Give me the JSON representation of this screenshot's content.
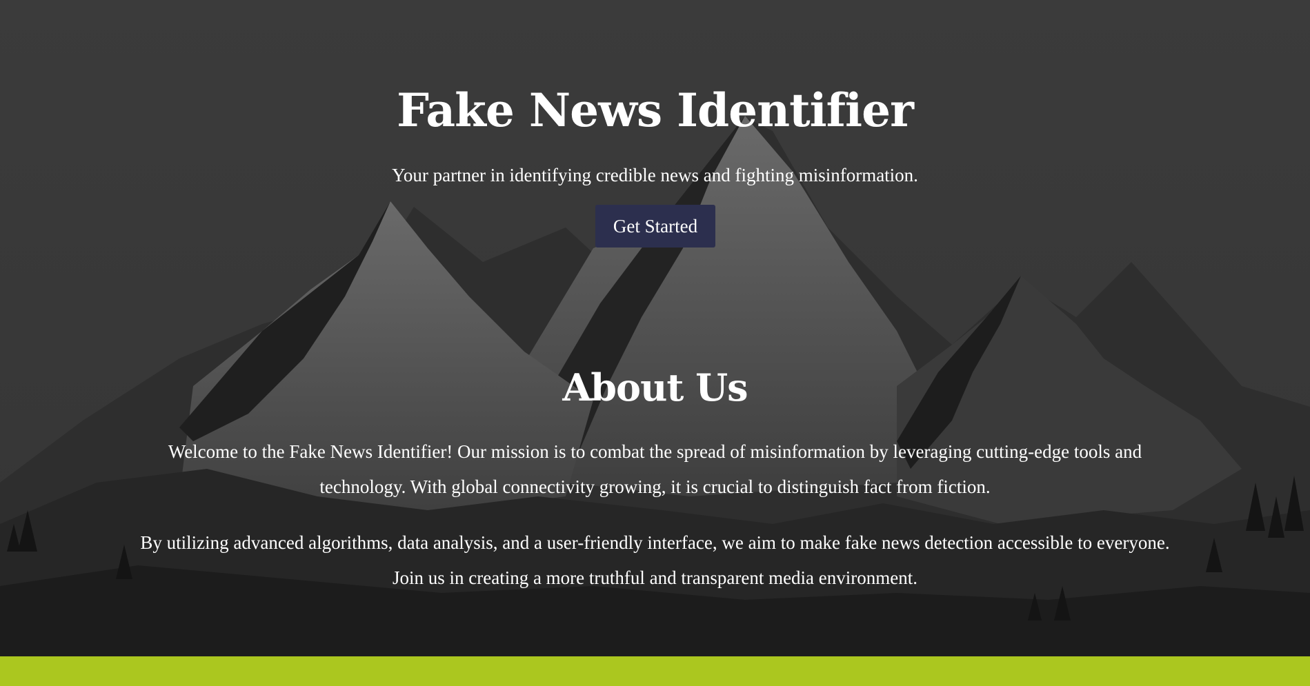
{
  "hero": {
    "title": "Fake News Identifier",
    "tagline": "Your partner in identifying credible news and fighting misinformation.",
    "cta_label": "Get Started"
  },
  "about": {
    "title": "About Us",
    "paragraphs": [
      "Welcome to the Fake News Identifier! Our mission is to combat the spread of misinformation by leveraging cutting-edge tools and technology. With global connectivity growing, it is crucial to distinguish fact from fiction.",
      "By utilizing advanced algorithms, data analysis, and a user-friendly interface, we aim to make fake news detection accessible to everyone. Join us in creating a more truthful and transparent media environment."
    ]
  },
  "colors": {
    "button_bg": "#2c2f4e",
    "band": "#abc71f",
    "text": "#ffffff",
    "background": "#2b2b2b"
  }
}
